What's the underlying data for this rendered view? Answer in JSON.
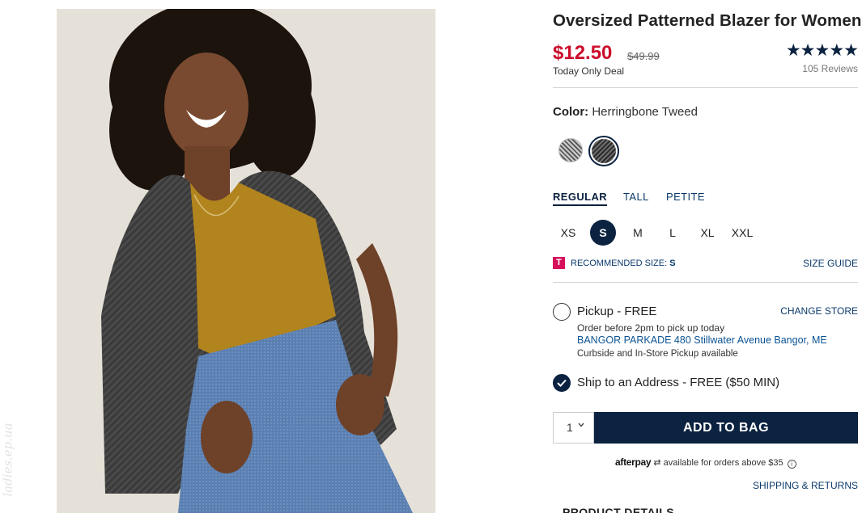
{
  "product": {
    "title": "Oversized Patterned Blazer for Women",
    "price": "$12.50",
    "original_price": "$49.99",
    "deal_label": "Today Only Deal",
    "rating_stars": "★★★★★",
    "rating_value": 5,
    "reviews": "105 Reviews"
  },
  "color": {
    "label": "Color:",
    "selected": "Herringbone Tweed",
    "swatches": [
      "light-herringbone",
      "herringbone-tweed"
    ]
  },
  "fit_tabs": [
    "REGULAR",
    "TALL",
    "PETITE"
  ],
  "sizes": [
    "XS",
    "S",
    "M",
    "L",
    "XL",
    "XXL"
  ],
  "selected_size": "S",
  "recommendation": {
    "icon_letter": "T",
    "label": "RECOMMENDED SIZE:",
    "size": "S",
    "size_guide": "SIZE GUIDE"
  },
  "pickup": {
    "label": "Pickup - FREE",
    "change_store": "CHANGE STORE",
    "note": "Order before 2pm to pick up today",
    "store": "BANGOR PARKADE 480 Stillwater Avenue  Bangor, ME",
    "availability": "Curbside and In-Store Pickup available"
  },
  "ship": {
    "label": "Ship to an Address - FREE ($50 MIN)"
  },
  "cart": {
    "quantity": "1",
    "add_label": "ADD TO BAG"
  },
  "afterpay": {
    "logo": "afterpay",
    "text": "available for orders above $35",
    "info": "i"
  },
  "shipping_returns": "SHIPPING & RETURNS",
  "product_details": "PRODUCT DETAILS",
  "watermark": "ladies.ep.ua",
  "colors": {
    "navy": "#0b2240",
    "sale_red": "#cc0e2b",
    "link_blue": "#0b3a6b",
    "badge_pink": "#d6105a"
  }
}
